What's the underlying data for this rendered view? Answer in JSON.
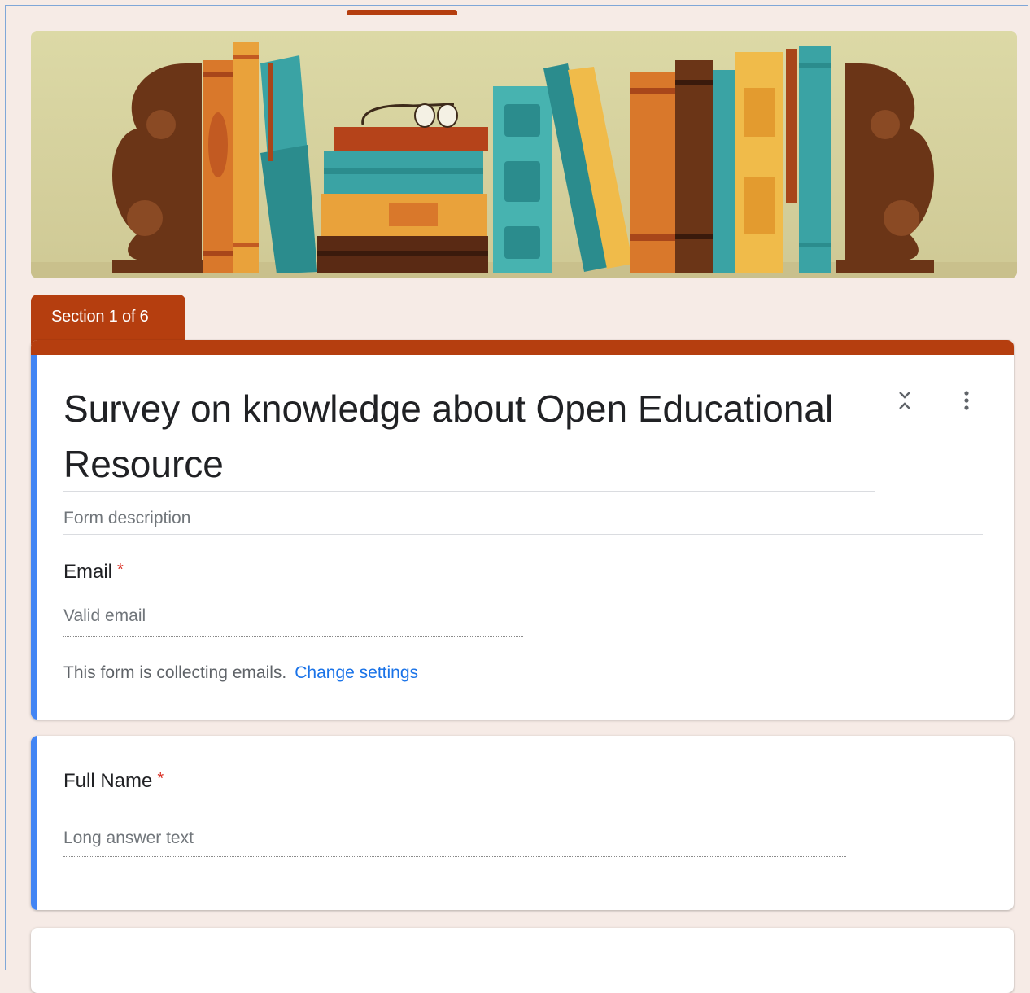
{
  "section_tab": {
    "label": "Section 1 of 6"
  },
  "header_card": {
    "title": "Survey on knowledge about Open Educational Resource",
    "description_placeholder": "Form description",
    "icons": {
      "collapse": "collapse-icon",
      "more": "more-vert-icon"
    }
  },
  "email_question": {
    "label": "Email",
    "required_mark": "*",
    "answer_placeholder": "Valid email",
    "note": "This form is collecting emails.",
    "note_link": "Change settings"
  },
  "fullname_question": {
    "label": "Full Name",
    "required_mark": "*",
    "answer_placeholder": "Long answer text"
  },
  "colors": {
    "theme": "#b53e0f",
    "background": "#f6ebe6",
    "focus_bar": "#4285f4",
    "link": "#1a73e8",
    "required": "#d93025"
  }
}
